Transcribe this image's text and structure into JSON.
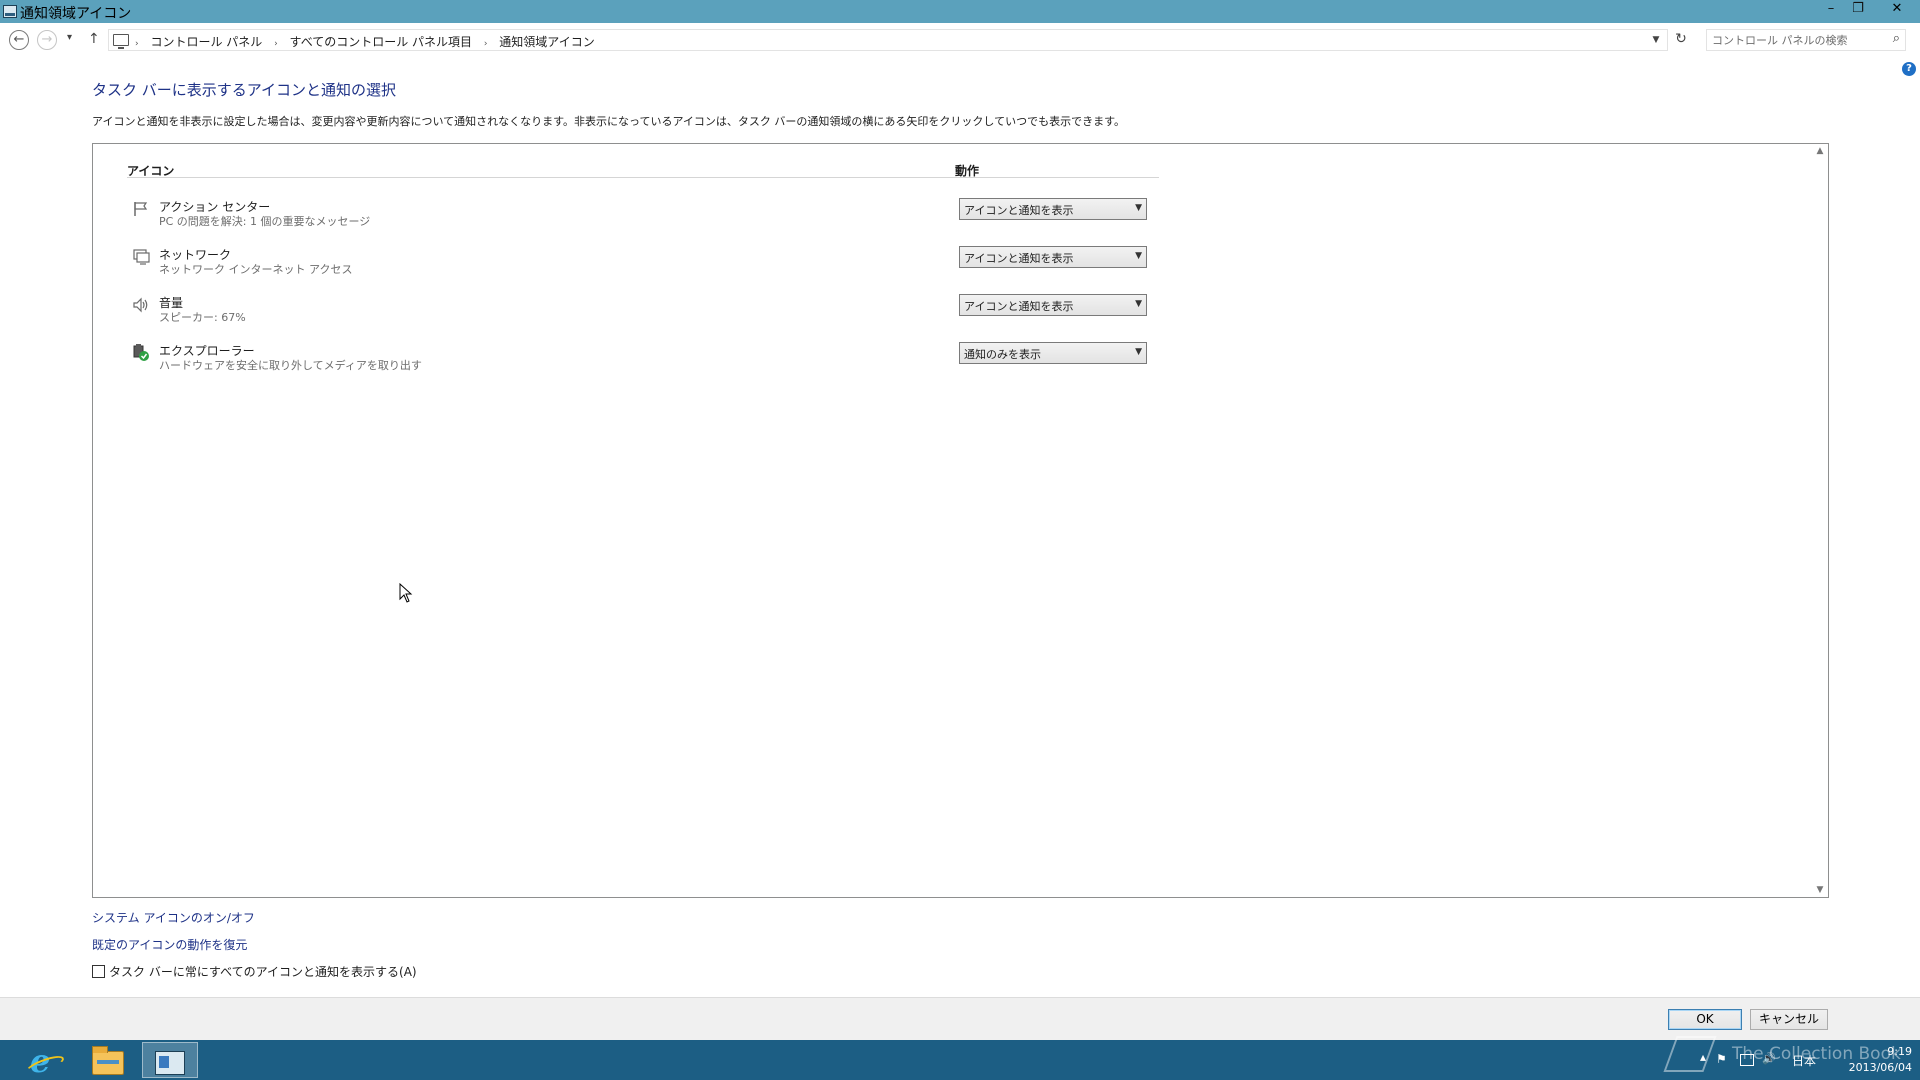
{
  "window": {
    "title": "通知領域アイコン",
    "minimize_glyph": "–",
    "restore_glyph": "❐",
    "close_glyph": "✕"
  },
  "navigation": {
    "back_glyph": "←",
    "forward_glyph": "→",
    "recent_glyph": "▾",
    "up_glyph": "↑",
    "breadcrumbs": [
      "コントロール パネル",
      "すべてのコントロール パネル項目",
      "通知領域アイコン"
    ],
    "breadcrumb_separator": "›",
    "refresh_glyph": "↻",
    "search_placeholder": "コントロール パネルの検索",
    "search_glyph": "⌕"
  },
  "help_glyph": "?",
  "page": {
    "heading": "タスク バーに表示するアイコンと通知の選択",
    "description": "アイコンと通知を非表示に設定した場合は、変更内容や更新内容について通知されなくなります。非表示になっているアイコンは、タスク バーの通知領域の横にある矢印をクリックしていつでも表示できます。"
  },
  "table": {
    "col_icon": "アイコン",
    "col_behavior": "動作",
    "rows": [
      {
        "name": "アクション センター",
        "status": "PC の問題を解決: 1 個の重要なメッセージ",
        "behavior": "アイコンと通知を表示",
        "icon": "flag-icon"
      },
      {
        "name": "ネットワーク",
        "status": "ネットワーク インターネット アクセス",
        "behavior": "アイコンと通知を表示",
        "icon": "network-icon"
      },
      {
        "name": "音量",
        "status": "スピーカー: 67%",
        "behavior": "アイコンと通知を表示",
        "icon": "speaker-icon"
      },
      {
        "name": "エクスプローラー",
        "status": "ハードウェアを安全に取り外してメディアを取り出す",
        "behavior": "通知のみを表示",
        "icon": "safely-remove-hardware-icon"
      }
    ]
  },
  "links": {
    "system_icons": "システム アイコンのオン/オフ",
    "restore_defaults": "既定のアイコンの動作を復元"
  },
  "always_show": {
    "label": "タスク バーに常にすべてのアイコンと通知を表示する(A)",
    "checked": false
  },
  "buttons": {
    "ok": "OK",
    "cancel": "キャンセル"
  },
  "taskbar": {
    "ie_glyph": "e",
    "tray_ime": "日本",
    "tray_flag_glyph": "⚑",
    "tray_volume_glyph": "🔊",
    "tray_up_glyph": "▴",
    "clock_time": "9:19",
    "clock_date": "2013/06/04",
    "watermark": "The Collection Book"
  },
  "colors": {
    "titlebar": "#5ba1bc",
    "taskbar": "#1c5e84",
    "link": "#1e3287"
  }
}
